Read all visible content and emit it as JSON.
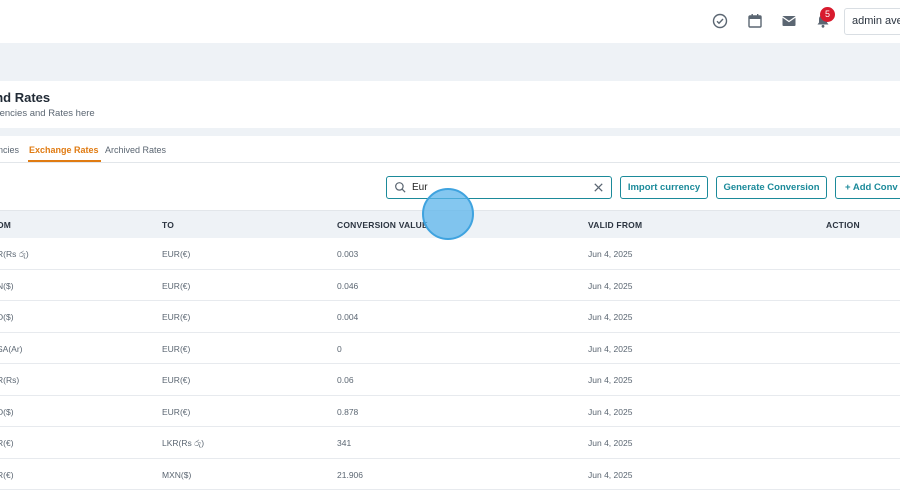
{
  "topbar": {
    "icons": [
      "check-circle-icon",
      "calendar-icon",
      "mail-icon",
      "bell-icon"
    ],
    "notification_count": "5",
    "user_name": "admin aven"
  },
  "page": {
    "title": "and Rates",
    "subtitle": "urrencies and Rates here"
  },
  "tabs": [
    {
      "label": "ncies"
    },
    {
      "label": "Exchange Rates"
    },
    {
      "label": "Archived Rates"
    }
  ],
  "search": {
    "value": "Eur"
  },
  "buttons": {
    "import": "Import currency",
    "generate": "Generate Conversion",
    "add": "+ Add Conv"
  },
  "table": {
    "headers": {
      "from": "OM",
      "to": "TO",
      "value": "CONVERSION VALUE",
      "valid": "VALID FROM",
      "action": "ACTION"
    },
    "rows": [
      {
        "from": "R(Rs රු)",
        "to": "EUR(€)",
        "value": "0.003",
        "valid": "Jun 4, 2025"
      },
      {
        "from": "N($)",
        "to": "EUR(€)",
        "value": "0.046",
        "valid": "Jun 4, 2025"
      },
      {
        "from": "D($)",
        "to": "EUR(€)",
        "value": "0.004",
        "valid": "Jun 4, 2025"
      },
      {
        "from": "SA(Ar)",
        "to": "EUR(€)",
        "value": "0",
        "valid": "Jun 4, 2025"
      },
      {
        "from": "R(Rs)",
        "to": "EUR(€)",
        "value": "0.06",
        "valid": "Jun 4, 2025"
      },
      {
        "from": "D($)",
        "to": "EUR(€)",
        "value": "0.878",
        "valid": "Jun 4, 2025"
      },
      {
        "from": "R(€)",
        "to": "LKR(Rs රු)",
        "value": "341",
        "valid": "Jun 4, 2025"
      },
      {
        "from": "R(€)",
        "to": "MXN($)",
        "value": "21.906",
        "valid": "Jun 4, 2025"
      }
    ]
  },
  "colors": {
    "accent": "#1b8a9a",
    "active_tab": "#e07b12",
    "badge": "#d81b2e"
  }
}
